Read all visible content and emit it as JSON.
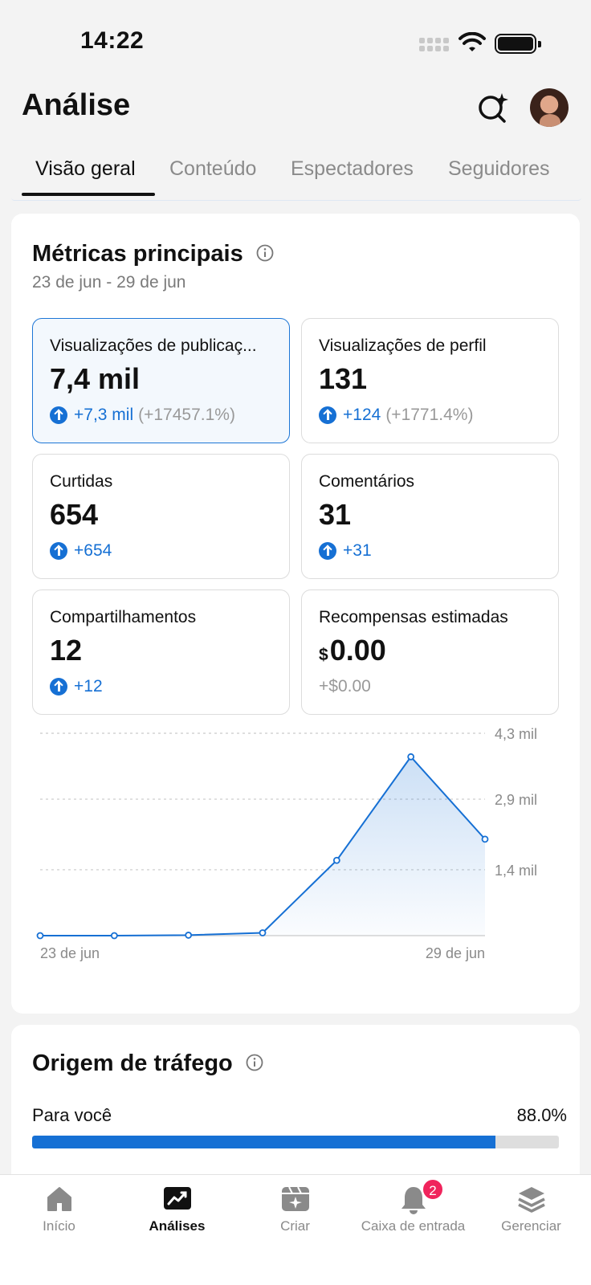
{
  "status_bar": {
    "time": "14:22"
  },
  "header": {
    "title": "Análise"
  },
  "tabs": [
    {
      "label": "Visão geral",
      "active": true
    },
    {
      "label": "Conteúdo"
    },
    {
      "label": "Espectadores"
    },
    {
      "label": "Seguidores"
    }
  ],
  "metrics": {
    "title": "Métricas principais",
    "date_range": "23 de jun - 29 de jun",
    "tiles": [
      {
        "label": "Visualizações de publicaç...",
        "value": "7,4 mil",
        "delta": "+7,3 mil",
        "pct": "(+17457.1%)",
        "selected": true
      },
      {
        "label": "Visualizações de perfil",
        "value": "131",
        "delta": "+124",
        "pct": "(+1771.4%)"
      },
      {
        "label": "Curtidas",
        "value": "654",
        "delta": "+654",
        "pct": ""
      },
      {
        "label": "Comentários",
        "value": "31",
        "delta": "+31",
        "pct": ""
      },
      {
        "label": "Compartilhamentos",
        "value": "12",
        "delta": "+12",
        "pct": ""
      },
      {
        "label": "Recompensas estimadas",
        "currency": "$",
        "value": "0.00",
        "delta": "+$0.00",
        "pct": ""
      }
    ]
  },
  "chart_data": {
    "type": "area",
    "x": [
      "23 de jun",
      "24 de jun",
      "25 de jun",
      "26 de jun",
      "27 de jun",
      "28 de jun",
      "29 de jun"
    ],
    "values": [
      0,
      0,
      10,
      60,
      1600,
      3800,
      2050
    ],
    "ylim": [
      0,
      4300
    ],
    "ytick_labels": [
      "4,3 mil",
      "2,9 mil",
      "1,4 mil"
    ],
    "ytick_values": [
      4300,
      2900,
      1400
    ],
    "xtick_labels": [
      "23 de jun",
      "29 de jun"
    ],
    "grid": true,
    "color": "#1670d4"
  },
  "traffic": {
    "title": "Origem de tráfego",
    "items": [
      {
        "label": "Para você",
        "value": "88.0%",
        "fraction": 0.88
      }
    ]
  },
  "bottom_nav": [
    {
      "label": "Início",
      "icon": "home-icon"
    },
    {
      "label": "Análises",
      "icon": "analytics-icon",
      "active": true
    },
    {
      "label": "Criar",
      "icon": "create-icon"
    },
    {
      "label": "Caixa de entrada",
      "icon": "bell-icon",
      "badge": "2"
    },
    {
      "label": "Gerenciar",
      "icon": "layers-icon"
    }
  ]
}
